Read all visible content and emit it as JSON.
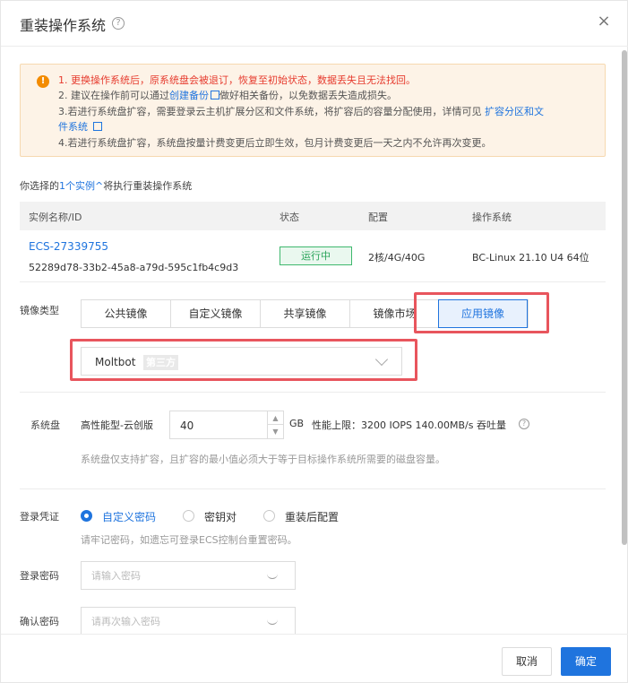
{
  "dialog": {
    "title": "重装操作系统",
    "help": "?",
    "close": "×"
  },
  "warning": {
    "line1": "1. 更换操作系统后，原系统盘会被退订，恢复至初始状态，数据丢失且无法找回。",
    "line2_prefix": "2. 建议在操作前可以通过",
    "line2_link": "创建备份",
    "line2_suffix": "做好相关备份，以免数据丢失造成损失。",
    "line3_prefix": "3.若进行系统盘扩容，需要登录云主机扩展分区和文件系统，将扩容后的容量分配使用，详情可见",
    "line3_link_a": "扩容分区和文",
    "line3_link_b": "件系统",
    "line4": "4.若进行系统盘扩容，系统盘按量计费变更后立即生效，包月计费变更后一天之内不允许再次变更。"
  },
  "selection": {
    "prefix": "你选择的",
    "count_link": "1个实例",
    "suffix": "将执行重装操作系统"
  },
  "table": {
    "headers": [
      "实例名称/ID",
      "状态",
      "配置",
      "操作系统"
    ],
    "rows": [
      {
        "name": "ECS-27339755",
        "id": "52289d78-33b2-45a8-a79d-595c1fb4c9d3",
        "status": "运行中",
        "config": "2核/4G/40G",
        "os": "BC-Linux 21.10 U4 64位"
      }
    ]
  },
  "image": {
    "label": "镜像类型",
    "tabs": [
      "公共镜像",
      "自定义镜像",
      "共享镜像",
      "镜像市场",
      "应用镜像"
    ],
    "active_tab": "应用镜像",
    "selected_value": "Moltbot",
    "selected_tag": "第三方"
  },
  "disk": {
    "label": "系统盘",
    "type": "高性能型-云创版",
    "size": "40",
    "unit": "GB",
    "perf": "性能上限：3200 IOPS    140.00MB/s 吞吐量",
    "hint": "系统盘仅支持扩容，且扩容的最小值必须大于等于目标操作系统所需要的磁盘容量。"
  },
  "login": {
    "label": "登录凭证",
    "options": [
      "自定义密码",
      "密钥对",
      "重装后配置"
    ],
    "selected": "自定义密码",
    "hint": "请牢记密码，如遗忘可登录ECS控制台重置密码。"
  },
  "password": {
    "label": "登录密码",
    "placeholder": "请输入密码"
  },
  "confirm": {
    "label": "确认密码",
    "placeholder": "请再次输入密码"
  },
  "footer": {
    "cancel": "取消",
    "ok": "确定"
  },
  "colors": {
    "primary": "#1f74de",
    "warning": "#f38b00",
    "danger_text": "#e63b2e",
    "success": "#2aa35a",
    "highlight": "#e8555d"
  }
}
